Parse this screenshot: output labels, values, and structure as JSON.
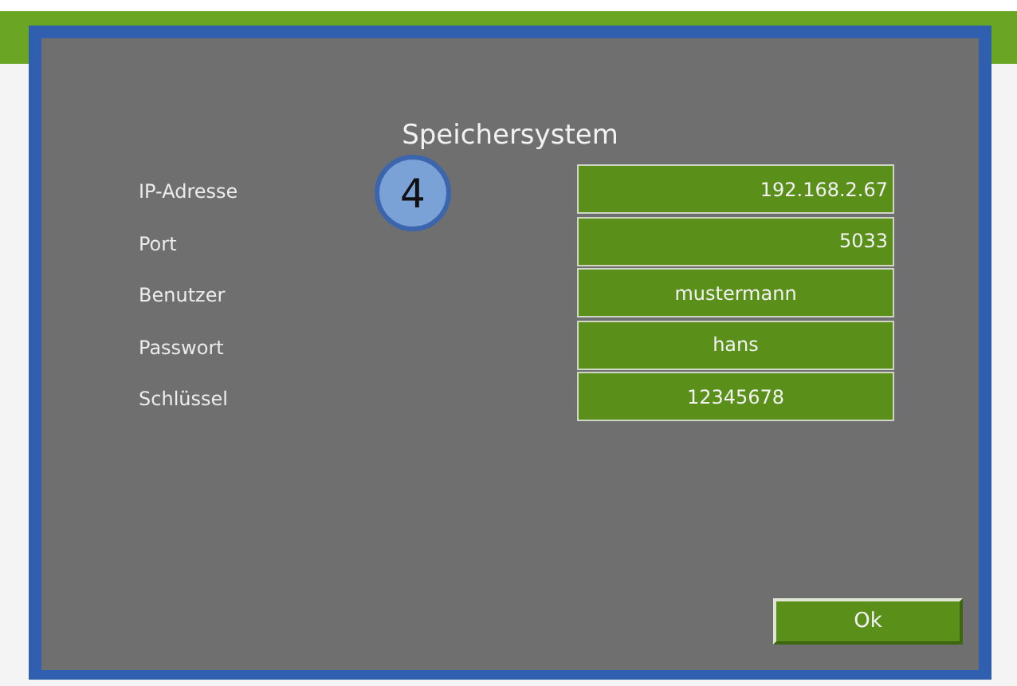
{
  "dialog": {
    "title": "Speichersystem"
  },
  "badge": {
    "label": "4"
  },
  "fields": [
    {
      "label": "IP-Adresse",
      "value": "192.168.2.67",
      "kind": "number"
    },
    {
      "label": "Port",
      "value": "5033",
      "kind": "number"
    },
    {
      "label": "Benutzer",
      "value": "mustermann",
      "kind": "text"
    },
    {
      "label": "Passwort",
      "value": "hans",
      "kind": "text"
    },
    {
      "label": "Schlüssel",
      "value": "12345678",
      "kind": "text"
    }
  ],
  "buttons": [
    {
      "label": "Ok"
    }
  ]
}
